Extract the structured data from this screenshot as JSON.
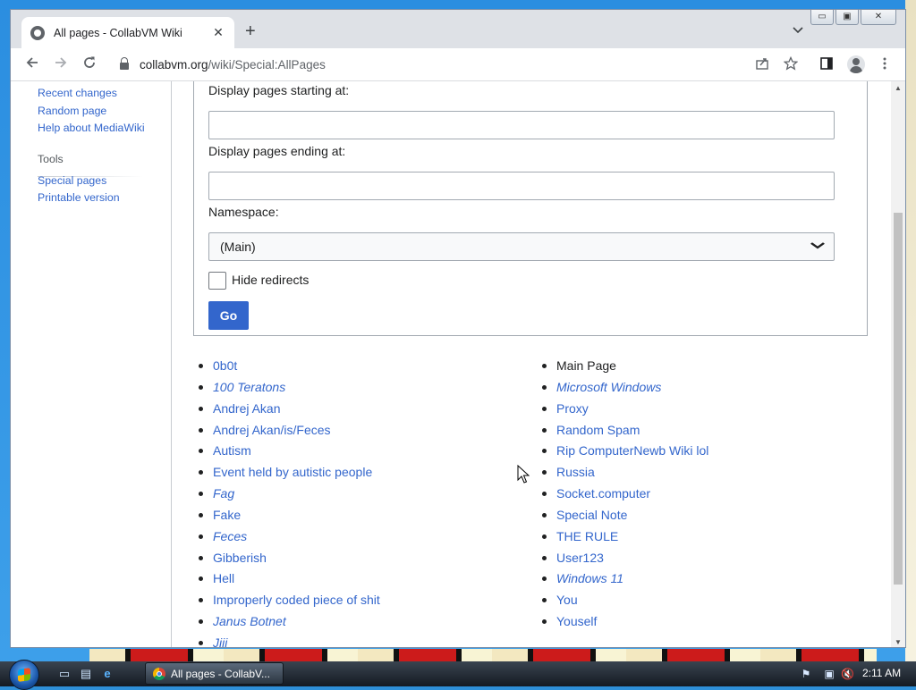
{
  "browser": {
    "tab_title": "All pages - CollabVM Wiki",
    "tab_close": "✕",
    "new_tab": "+",
    "url_host": "collabvm.org",
    "url_path": "/wiki/Special:AllPages",
    "window_controls": {
      "minimize": "▭",
      "maximize": "▣",
      "close": "✕"
    }
  },
  "sidebar": {
    "nav_links": [
      "Recent changes",
      "Random page",
      "Help about MediaWiki"
    ],
    "tools_title": "Tools",
    "tools_links": [
      "Special pages",
      "Printable version"
    ]
  },
  "form": {
    "start_label": "Display pages starting at:",
    "start_value": "",
    "end_label": "Display pages ending at:",
    "end_value": "",
    "namespace_label": "Namespace:",
    "namespace_value": "(Main)",
    "hide_redirects_label": "Hide redirects",
    "hide_redirects_checked": false,
    "go_label": "Go"
  },
  "pages": {
    "column1": [
      {
        "title": "0b0t",
        "redirect": false
      },
      {
        "title": "100 Teratons",
        "redirect": true
      },
      {
        "title": "Andrej Akan",
        "redirect": false
      },
      {
        "title": "Andrej Akan/is/Feces",
        "redirect": false
      },
      {
        "title": "Autism",
        "redirect": false
      },
      {
        "title": "Event held by autistic people",
        "redirect": false
      },
      {
        "title": "Fag",
        "redirect": true
      },
      {
        "title": "Fake",
        "redirect": false
      },
      {
        "title": "Feces",
        "redirect": true
      },
      {
        "title": "Gibberish",
        "redirect": false
      },
      {
        "title": "Hell",
        "redirect": false
      },
      {
        "title": "Improperly coded piece of shit",
        "redirect": false
      },
      {
        "title": "Janus Botnet",
        "redirect": true
      },
      {
        "title": "Jjjj",
        "redirect": true
      }
    ],
    "column2": [
      {
        "title": "Main Page",
        "redirect": false,
        "self": true
      },
      {
        "title": "Microsoft Windows",
        "redirect": true
      },
      {
        "title": "Proxy",
        "redirect": false
      },
      {
        "title": "Random Spam",
        "redirect": false
      },
      {
        "title": "Rip ComputerNewb Wiki lol",
        "redirect": false
      },
      {
        "title": "Russia",
        "redirect": false
      },
      {
        "title": "Socket.computer",
        "redirect": false
      },
      {
        "title": "Special Note",
        "redirect": false
      },
      {
        "title": "THE RULE",
        "redirect": false
      },
      {
        "title": "User123",
        "redirect": false
      },
      {
        "title": "Windows 11",
        "redirect": true
      },
      {
        "title": "You",
        "redirect": false
      },
      {
        "title": "Youself",
        "redirect": false
      }
    ]
  },
  "taskbar": {
    "task_button_label": "All pages - CollabV...",
    "clock": "2:11 AM"
  },
  "colors": {
    "link": "#3366cc",
    "go_button": "#3366cc",
    "text": "#202122"
  }
}
